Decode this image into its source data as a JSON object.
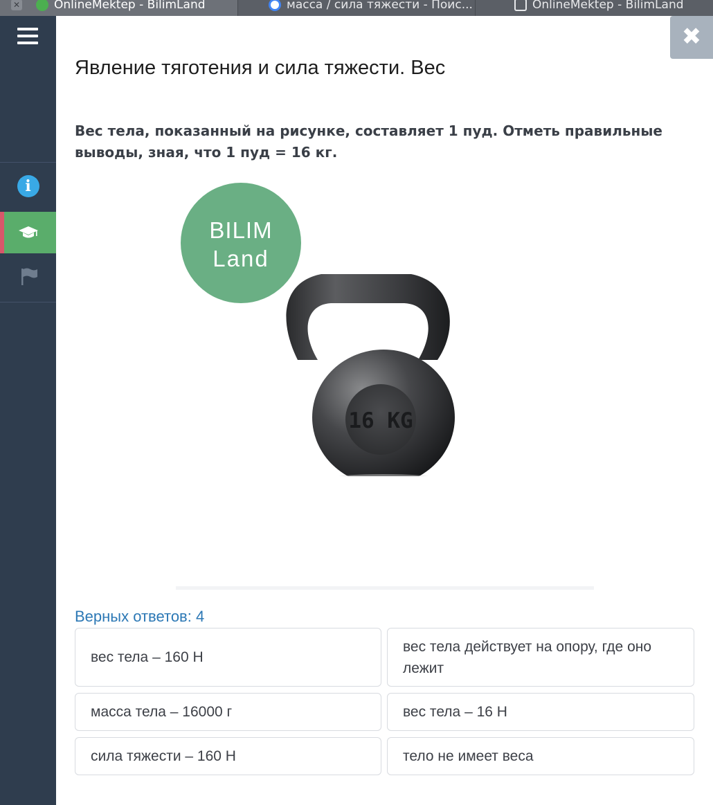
{
  "browser": {
    "tabs": [
      {
        "title": "OnlineMektep - BilimLand",
        "active": true
      },
      {
        "title": "масса / сила тяжести - Поис...",
        "active": false
      },
      {
        "title": "OnlineMektep - BilimLand",
        "active": false
      }
    ]
  },
  "sidebar": {
    "items": [
      {
        "icon": "info-icon"
      },
      {
        "icon": "graduation-cap-icon",
        "active": true
      },
      {
        "icon": "flag-icon"
      }
    ]
  },
  "page": {
    "title": "Явление тяготения и сила тяжести. Вес",
    "question": "Вес тела, показанный на рисунке, составляет 1 пуд. Отметь правильные выводы, зная, что 1 пуд = 16 кг."
  },
  "figure": {
    "logo_line1": "BILIM",
    "logo_line2": "Land",
    "kettlebell_label": "16 KG"
  },
  "quiz": {
    "answers_count": "Верных ответов: 4",
    "options": [
      "вес тела – 160 Н",
      "вес тела действует на опору, где оно лежит",
      "масса тела – 16000 г",
      "вес тела – 16 Н",
      "сила тяжести – 160 Н",
      "тело не имеет веса"
    ]
  },
  "colors": {
    "sidebar_bg": "#2f3d4e",
    "sidebar_active": "#5aad6b",
    "accent_red": "#d8576a",
    "info_blue": "#39a9e6",
    "answers_count_text": "#2c78b5",
    "logo_green": "#6aaf84",
    "close_button_bg": "#a8b2bd"
  }
}
